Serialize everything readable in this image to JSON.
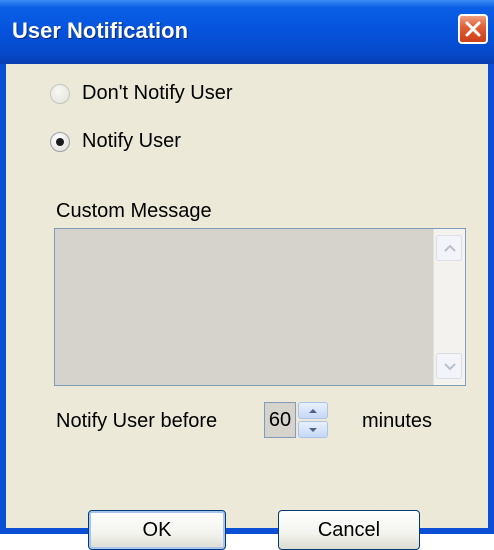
{
  "window": {
    "title": "User Notification"
  },
  "options": [
    {
      "label": "Don't Notify User",
      "selected": false,
      "enabled": false
    },
    {
      "label": "Notify User",
      "selected": true,
      "enabled": true
    }
  ],
  "custom_message": {
    "label": "Custom Message",
    "value": ""
  },
  "notify_before": {
    "label": "Notify User before",
    "value": "60",
    "unit_label": "minutes"
  },
  "buttons": {
    "ok_label": "OK",
    "cancel_label": "Cancel"
  },
  "colors": {
    "titlebar": "#0654dd",
    "close_button": "#e0603a",
    "dialog_background": "#ece9d8"
  }
}
